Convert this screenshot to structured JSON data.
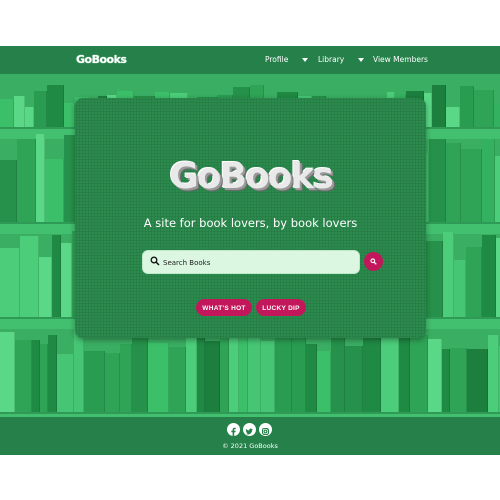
{
  "navbar": {
    "brand": "GoBooks",
    "items": [
      {
        "label": "Profile"
      },
      {
        "label": "Library"
      },
      {
        "label": "View Members"
      }
    ]
  },
  "hero": {
    "logo": "GoBooks",
    "tagline": "A site for book lovers, by book lovers",
    "search": {
      "placeholder": "Search Books",
      "value": ""
    },
    "buttons": [
      {
        "label": "WHAT'S HOT"
      },
      {
        "label": "LUCKY DIP"
      }
    ]
  },
  "footer": {
    "social_icons": [
      "facebook-icon",
      "twitter-icon",
      "instagram-icon"
    ],
    "copyright": "© 2021 GoBooks"
  },
  "colors": {
    "nav_green": "#25804a",
    "card_green": "#2b8a4d",
    "accent_pink": "#c2185b",
    "search_bg": "#dbf7e2"
  }
}
